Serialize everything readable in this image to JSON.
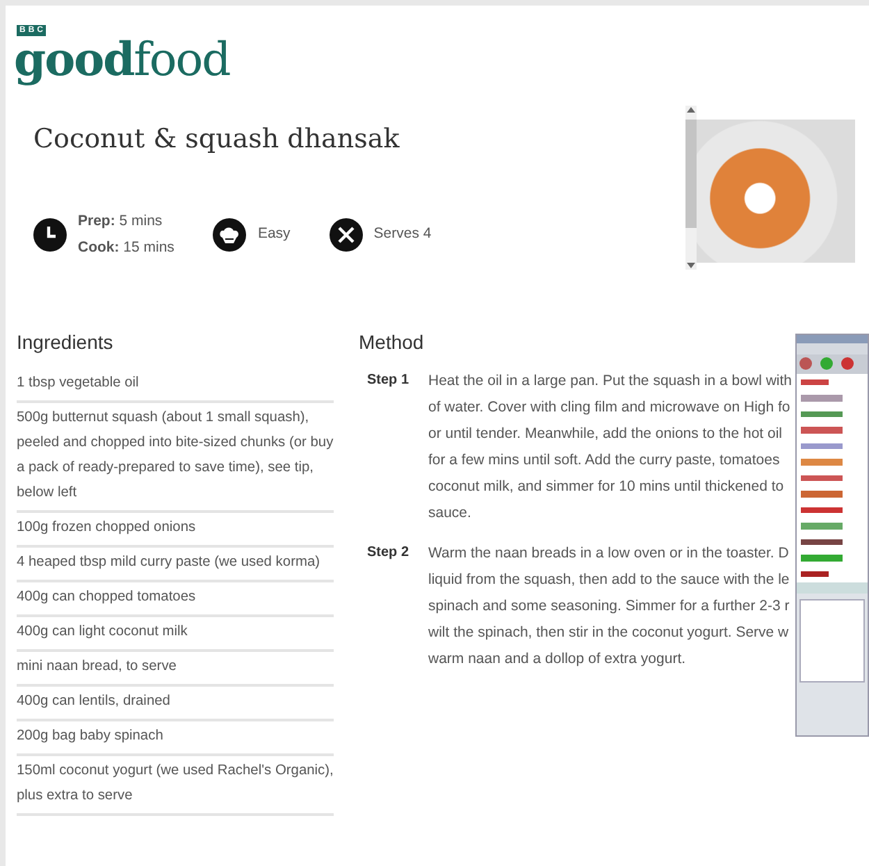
{
  "logo": {
    "network": "BBC",
    "brand_bold": "good",
    "brand_light": "food"
  },
  "recipe_title": "Coconut & squash dhansak",
  "meta": [
    {
      "kind": "time",
      "lines": [
        "**Prep:** 5 mins",
        "**Cook:** 15 mins"
      ]
    },
    {
      "kind": "difficulty",
      "lines": [
        "Easy"
      ]
    },
    {
      "kind": "serves",
      "lines": [
        "Serves 4"
      ]
    }
  ],
  "ingredients": {
    "heading": "Ingredients",
    "items": [
      "1 tbsp vegetable oil",
      "500g butternut squash (about 1 small squash), peeled and chopped into bite-sized chunks (or buy a pack of ready-prepared to save time), see tip, below left",
      "100g frozen chopped onions",
      "4 heaped tbsp mild curry paste (we used korma)",
      "400g can chopped tomatoes",
      "400g can light coconut milk",
      "mini naan bread, to serve",
      "400g can lentils, drained",
      "200g bag baby spinach",
      "150ml coconut yogurt (we used Rachel's Organic), plus extra to serve"
    ]
  },
  "method": {
    "heading": "Method",
    "steps": [
      {
        "label": "Step 1",
        "lines": [
          "Heat the oil in a large pan. Put the squash in a bowl with",
          "of water. Cover with cling film and microwave on High fo",
          "or until tender. Meanwhile, add the onions to the hot oil",
          "for a few mins until soft. Add the curry paste, tomatoes",
          "coconut milk, and simmer for 10 mins until thickened to",
          "sauce."
        ]
      },
      {
        "label": "Step 2",
        "lines": [
          "Warm the naan breads in a low oven or in the toaster. D",
          "liquid from the squash, then add to the sauce with the le",
          "spinach and some seasoning. Simmer for a further 2-3 r",
          "wilt the spinach, then stir in the coconut yogurt. Serve w",
          "warm naan and a dollop of extra yogurt."
        ]
      }
    ]
  }
}
